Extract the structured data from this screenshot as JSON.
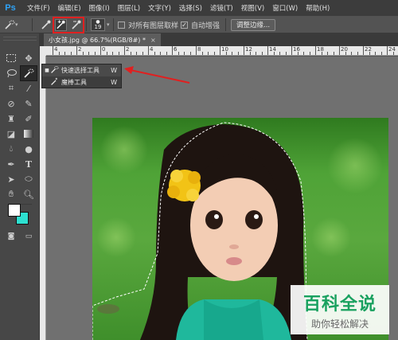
{
  "app": {
    "logo": "Ps"
  },
  "menu": [
    "文件(F)",
    "编辑(E)",
    "图像(I)",
    "图层(L)",
    "文字(Y)",
    "选择(S)",
    "滤镜(T)",
    "视图(V)",
    "窗口(W)",
    "帮助(H)"
  ],
  "options": {
    "brush_size": "19",
    "sample_all_layers": "对所有图层取样",
    "auto_enhance": "自动增强",
    "refine_edge": "调整边缘..."
  },
  "document": {
    "tab_title": "小女孩.jpg @ 66.7%(RGB/8#) *"
  },
  "ruler": {
    "labels": [
      "4",
      "2",
      "0",
      "2",
      "4",
      "6",
      "8",
      "10",
      "12",
      "14",
      "16",
      "18",
      "20",
      "22",
      "24"
    ]
  },
  "flyout": {
    "items": [
      {
        "label": "快速选择工具",
        "shortcut": "W",
        "active": true
      },
      {
        "label": "魔棒工具",
        "shortcut": "W",
        "active": false
      }
    ]
  },
  "colors": {
    "foreground": "#ffffff",
    "background": "#2de0d0",
    "annotation": "#e02020",
    "watermark": "#19a15f"
  },
  "watermark": {
    "title": "百科全说",
    "subtitle": "助你轻松解决"
  },
  "icons": [
    "marquee-icon",
    "move-icon",
    "lasso-icon",
    "quick-selection-icon",
    "crop-icon",
    "eyedropper-icon",
    "healing-icon",
    "brush-icon",
    "stamp-icon",
    "history-brush-icon",
    "eraser-icon",
    "gradient-icon",
    "blur-icon",
    "dodge-icon",
    "pen-icon",
    "type-icon",
    "path-select-icon",
    "shape-icon",
    "hand-icon",
    "zoom-icon"
  ]
}
